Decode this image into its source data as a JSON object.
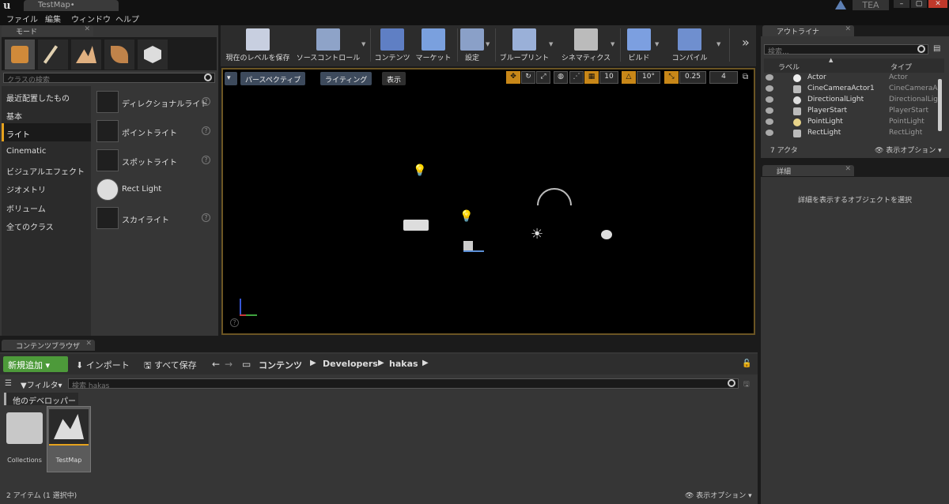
{
  "window": {
    "doc_tab": "TestMap•",
    "user": "TEA"
  },
  "menubar": [
    "ファイル",
    "編集",
    "ウィンドウ",
    "ヘルプ"
  ],
  "modes": {
    "tab": "モード",
    "search_placeholder": "クラスの検索",
    "categories": [
      "最近配置したもの",
      "基本",
      "ライト",
      "Cinematic",
      "ビジュアルエフェクト",
      "ジオメトリ",
      "ボリューム",
      "全てのクラス"
    ],
    "selected_category": "ライト",
    "items": [
      "ディレクショナルライト",
      "ポイントライト",
      "スポットライト",
      "Rect Light",
      "スカイライト"
    ]
  },
  "toolbar": {
    "buttons": [
      "現在のレベルを保存",
      "ソースコントロール",
      "コンテンツ",
      "マーケット",
      "設定",
      "ブループリント",
      "シネマティクス",
      "ビルド",
      "コンパイル"
    ],
    "more": "»"
  },
  "viewport": {
    "perspective": "パースペクティブ",
    "lighting": "ライティング",
    "show": "表示",
    "grid_snap": "10",
    "rot_snap": "10°",
    "scale_snap": "0.25",
    "cam_speed": "4"
  },
  "content_browser": {
    "tab": "コンテンツブラウザ",
    "add_new": "新規追加",
    "import": "インポート",
    "save_all": "すべて保存",
    "path": [
      "コンテンツ",
      "Developers",
      "hakas"
    ],
    "filter": "フィルタ",
    "search_placeholder": "検索 hakas",
    "folder_tag": "他のデベロッパー",
    "assets": [
      {
        "label": "Collections"
      },
      {
        "label": "TestMap"
      }
    ],
    "status": "2 アイテム (1 選択中)",
    "view_options": "表示オプション"
  },
  "outliner": {
    "tab": "アウトライナ",
    "search_placeholder": "検索...",
    "col_label": "ラベル",
    "col_type": "タイプ",
    "rows": [
      {
        "label": "Actor",
        "type": "Actor"
      },
      {
        "label": "CineCameraActor1",
        "type": "CineCameraA"
      },
      {
        "label": "DirectionalLight",
        "type": "DirectionalLig"
      },
      {
        "label": "PlayerStart",
        "type": "PlayerStart"
      },
      {
        "label": "PointLight",
        "type": "PointLight"
      },
      {
        "label": "RectLight",
        "type": "RectLight"
      }
    ],
    "count": "7 アクタ",
    "view_options": "表示オプション"
  },
  "details": {
    "tab": "詳細",
    "hint": "詳細を表示するオブジェクトを選択"
  }
}
